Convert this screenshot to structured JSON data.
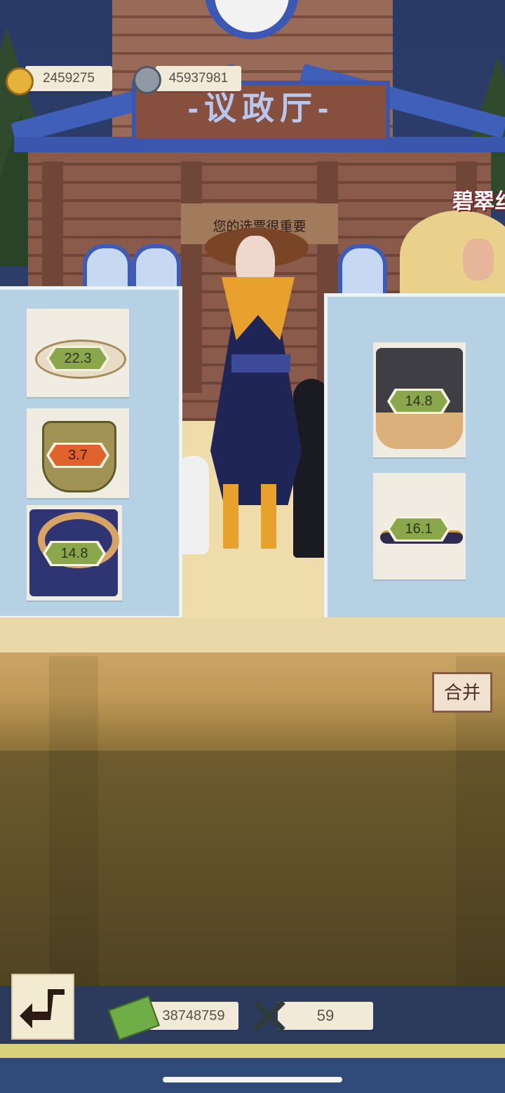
{
  "header": {
    "gold_amount": "2459275",
    "gem_amount": "45937981"
  },
  "building": {
    "sign": "-议政厅-",
    "notice": "您的选票很重要",
    "side_label": "碧翠丝"
  },
  "left_items": [
    {
      "icon": "straw-hat-icon",
      "value": "22.3",
      "badge_color": "#8aa74c"
    },
    {
      "icon": "woven-basket-icon",
      "value": "3.7",
      "badge_color": "#e0622d"
    },
    {
      "icon": "scarf-icon",
      "value": "14.8",
      "badge_color": "#8aa74c"
    }
  ],
  "right_items": [
    {
      "icon": "coat-icon",
      "value": "14.8",
      "badge_color": "#8aa74c"
    },
    {
      "icon": "shoes-icon",
      "value": "16.1",
      "badge_color": "#8aa74c"
    }
  ],
  "merge_button": "合并",
  "footer": {
    "money_amount": "38748759",
    "tickets_amount": "59"
  }
}
